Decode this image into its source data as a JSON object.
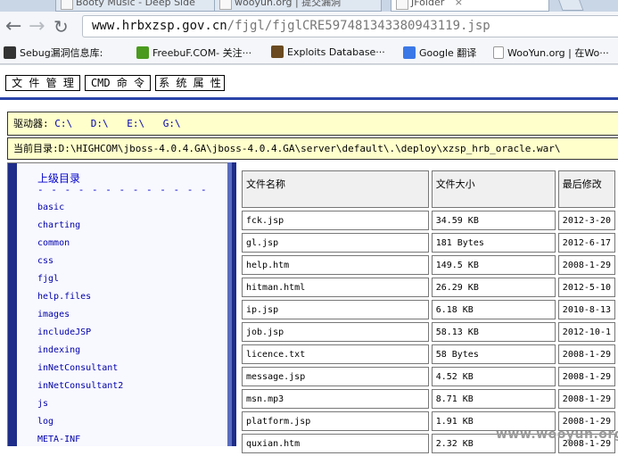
{
  "browser": {
    "tabs": [
      {
        "title": "Booty Music - Deep Side"
      },
      {
        "title": "wooyun.org | 提交漏洞"
      },
      {
        "title": "JFolder"
      }
    ],
    "url_host": "www.hrbxzsp.gov.cn",
    "url_path": "/fjgl/fjglCRE597481343380943119.jsp",
    "bookmarks": [
      {
        "label": "Sebug漏洞信息库:",
        "icon": "sebug-icon",
        "color": "#333333"
      },
      {
        "label": "FreebuF.COM- 关注···",
        "icon": "freebuf-icon",
        "color": "#4a9a1e"
      },
      {
        "label": "Exploits Database···",
        "icon": "exploitdb-icon",
        "color": "#6a4a20"
      },
      {
        "label": "Google 翻译",
        "icon": "google-translate-icon",
        "color": "#3b78e7"
      },
      {
        "label": "WooYun.org | 在Wo···",
        "icon": "page-icon",
        "color": "#ffffff"
      }
    ]
  },
  "page": {
    "buttons": [
      "文 件 管 理",
      "CMD 命 令",
      "系 统 属 性"
    ],
    "drives_label": "驱动器:",
    "drives": [
      "C:\\",
      "D:\\",
      "E:\\",
      "G:\\"
    ],
    "current_dir": "当前目录:D:\\HIGHCOM\\jboss-4.0.4.GA\\jboss-4.0.4.GA\\server\\default\\.\\deploy\\xzsp_hrb_oracle.war\\",
    "parent_dir": "上级目录",
    "dashes": "- - - - - - - - - - - - -",
    "directories": [
      "basic",
      "charting",
      "common",
      "css",
      "fjgl",
      "help.files",
      "images",
      "includeJSP",
      "indexing",
      "inNetConsultant",
      "inNetConsultant2",
      "js",
      "log",
      "META-INF"
    ],
    "table_headers": [
      "文件名称",
      "文件大小",
      "最后修改"
    ],
    "files": [
      {
        "name": "fck.jsp",
        "size": "34.59 KB",
        "modified": "2012-3-20"
      },
      {
        "name": "gl.jsp",
        "size": "181 Bytes",
        "modified": "2012-6-17"
      },
      {
        "name": "help.htm",
        "size": "149.5 KB",
        "modified": "2008-1-29"
      },
      {
        "name": "hitman.html",
        "size": "26.29 KB",
        "modified": "2012-5-10"
      },
      {
        "name": "ip.jsp",
        "size": "6.18 KB",
        "modified": "2010-8-13"
      },
      {
        "name": "job.jsp",
        "size": "58.13 KB",
        "modified": "2012-10-1"
      },
      {
        "name": "licence.txt",
        "size": "58 Bytes",
        "modified": "2008-1-29"
      },
      {
        "name": "message.jsp",
        "size": "4.52 KB",
        "modified": "2008-1-29"
      },
      {
        "name": "msn.mp3",
        "size": "8.71 KB",
        "modified": "2008-1-29"
      },
      {
        "name": "platform.jsp",
        "size": "1.91 KB",
        "modified": "2008-1-29"
      },
      {
        "name": "quxian.htm",
        "size": "2.32 KB",
        "modified": "2008-1-29"
      }
    ],
    "watermark": "www.wooyun.org"
  }
}
